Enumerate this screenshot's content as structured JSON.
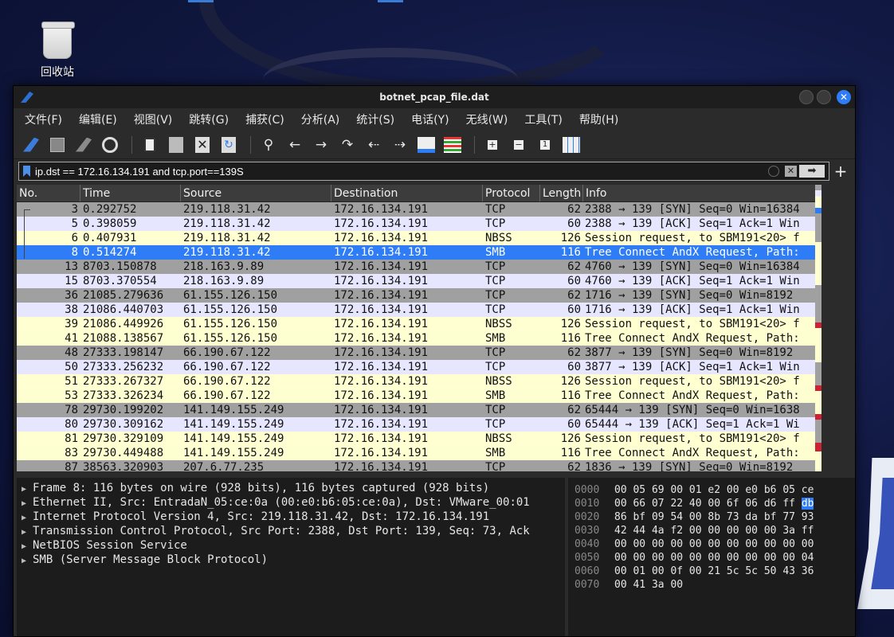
{
  "desktop": {
    "recycle_label": "回收站"
  },
  "window": {
    "title": "botnet_pcap_file.dat",
    "close_glyph": "✕"
  },
  "menu": [
    "文件(F)",
    "编辑(E)",
    "视图(V)",
    "跳转(G)",
    "捕获(C)",
    "分析(A)",
    "统计(S)",
    "电话(Y)",
    "无线(W)",
    "工具(T)",
    "帮助(H)"
  ],
  "toolbar": {
    "icons": [
      "shark-fin-start-icon",
      "stop-square-icon",
      "restart-fin-icon",
      "gear-options-icon",
      "open-file-icon",
      "file-set-icon",
      "close-file-icon",
      "reload-icon",
      "search-icon",
      "back-arrow-icon",
      "forward-arrow-icon",
      "goto-packet-icon",
      "first-packet-icon",
      "last-packet-icon",
      "autoscroll-icon",
      "colorize-icon",
      "zoom-in-icon",
      "zoom-out-icon",
      "normal-size-icon",
      "resize-columns-icon"
    ]
  },
  "filter": {
    "value": "ip.dst == 172.16.134.191 and tcp.port==139S",
    "apply_glyph": "➡",
    "plus": "+"
  },
  "columns": [
    "No.",
    "Time",
    "Source",
    "Destination",
    "Protocol",
    "Length",
    "Info"
  ],
  "packets": [
    {
      "no": "3",
      "time": "0.292752",
      "src": "219.118.31.42",
      "dst": "172.16.134.191",
      "proto": "TCP",
      "len": "62",
      "info": "2388 → 139 [SYN] Seq=0 Win=16384",
      "kind": "tcp"
    },
    {
      "no": "5",
      "time": "0.398059",
      "src": "219.118.31.42",
      "dst": "172.16.134.191",
      "proto": "TCP",
      "len": "60",
      "info": "2388 → 139 [ACK] Seq=1 Ack=1 Win",
      "kind": "tcp2"
    },
    {
      "no": "6",
      "time": "0.407931",
      "src": "219.118.31.42",
      "dst": "172.16.134.191",
      "proto": "NBSS",
      "len": "126",
      "info": "Session request, to SBM191<20> f",
      "kind": "nbss"
    },
    {
      "no": "8",
      "time": "0.514274",
      "src": "219.118.31.42",
      "dst": "172.16.134.191",
      "proto": "SMB",
      "len": "116",
      "info": "Tree Connect AndX Request, Path:",
      "kind": "sel"
    },
    {
      "no": "13",
      "time": "8703.150878",
      "src": "218.163.9.89",
      "dst": "172.16.134.191",
      "proto": "TCP",
      "len": "62",
      "info": "4760 → 139 [SYN] Seq=0 Win=16384",
      "kind": "tcp"
    },
    {
      "no": "15",
      "time": "8703.370554",
      "src": "218.163.9.89",
      "dst": "172.16.134.191",
      "proto": "TCP",
      "len": "60",
      "info": "4760 → 139 [ACK] Seq=1 Ack=1 Win",
      "kind": "tcp2"
    },
    {
      "no": "36",
      "time": "21085.279636",
      "src": "61.155.126.150",
      "dst": "172.16.134.191",
      "proto": "TCP",
      "len": "62",
      "info": "1716 → 139 [SYN] Seq=0 Win=8192",
      "kind": "tcp"
    },
    {
      "no": "38",
      "time": "21086.440703",
      "src": "61.155.126.150",
      "dst": "172.16.134.191",
      "proto": "TCP",
      "len": "60",
      "info": "1716 → 139 [ACK] Seq=1 Ack=1 Win",
      "kind": "tcp2"
    },
    {
      "no": "39",
      "time": "21086.449926",
      "src": "61.155.126.150",
      "dst": "172.16.134.191",
      "proto": "NBSS",
      "len": "126",
      "info": "Session request, to SBM191<20> f",
      "kind": "nbss"
    },
    {
      "no": "41",
      "time": "21088.138567",
      "src": "61.155.126.150",
      "dst": "172.16.134.191",
      "proto": "SMB",
      "len": "116",
      "info": "Tree Connect AndX Request, Path:",
      "kind": "smb"
    },
    {
      "no": "48",
      "time": "27333.198147",
      "src": "66.190.67.122",
      "dst": "172.16.134.191",
      "proto": "TCP",
      "len": "62",
      "info": "3877 → 139 [SYN] Seq=0 Win=8192",
      "kind": "tcp"
    },
    {
      "no": "50",
      "time": "27333.256232",
      "src": "66.190.67.122",
      "dst": "172.16.134.191",
      "proto": "TCP",
      "len": "60",
      "info": "3877 → 139 [ACK] Seq=1 Ack=1 Win",
      "kind": "tcp2"
    },
    {
      "no": "51",
      "time": "27333.267327",
      "src": "66.190.67.122",
      "dst": "172.16.134.191",
      "proto": "NBSS",
      "len": "126",
      "info": "Session request, to SBM191<20> f",
      "kind": "nbss"
    },
    {
      "no": "53",
      "time": "27333.326234",
      "src": "66.190.67.122",
      "dst": "172.16.134.191",
      "proto": "SMB",
      "len": "116",
      "info": "Tree Connect AndX Request, Path:",
      "kind": "smb"
    },
    {
      "no": "78",
      "time": "29730.199202",
      "src": "141.149.155.249",
      "dst": "172.16.134.191",
      "proto": "TCP",
      "len": "62",
      "info": "65444 → 139 [SYN] Seq=0 Win=1638",
      "kind": "tcp"
    },
    {
      "no": "80",
      "time": "29730.309162",
      "src": "141.149.155.249",
      "dst": "172.16.134.191",
      "proto": "TCP",
      "len": "60",
      "info": "65444 → 139 [ACK] Seq=1 Ack=1 Wi",
      "kind": "tcp2"
    },
    {
      "no": "81",
      "time": "29730.329109",
      "src": "141.149.155.249",
      "dst": "172.16.134.191",
      "proto": "NBSS",
      "len": "126",
      "info": "Session request, to SBM191<20> f",
      "kind": "nbss"
    },
    {
      "no": "83",
      "time": "29730.449488",
      "src": "141.149.155.249",
      "dst": "172.16.134.191",
      "proto": "SMB",
      "len": "116",
      "info": "Tree Connect AndX Request, Path:",
      "kind": "smb"
    },
    {
      "no": "87",
      "time": "38563.320903",
      "src": "207.6.77.235",
      "dst": "172.16.134.191",
      "proto": "TCP",
      "len": "62",
      "info": "1836 → 139 [SYN] Seq=0 Win=8192",
      "kind": "tcp"
    }
  ],
  "details": [
    "Frame 8: 116 bytes on wire (928 bits), 116 bytes captured (928 bits)",
    "Ethernet II, Src: EntradaN_05:ce:0a (00:e0:b6:05:ce:0a), Dst: VMware_00:01",
    "Internet Protocol Version 4, Src: 219.118.31.42, Dst: 172.16.134.191",
    "Transmission Control Protocol, Src Port: 2388, Dst Port: 139, Seq: 73, Ack",
    "NetBIOS Session Service",
    "SMB (Server Message Block Protocol)"
  ],
  "bytes": [
    {
      "off": "0000",
      "hex": "00 05 69 00 01 e2 00 e0  b6 05 ce",
      "hl": ""
    },
    {
      "off": "0010",
      "hex": "00 66 07 22 40 00 6f 06  d6 ff ",
      "hl": "db"
    },
    {
      "off": "0020",
      "hex": "86 bf 09 54 00 8b 73 da  bf 77 93",
      "hl": ""
    },
    {
      "off": "0030",
      "hex": "42 44 4a f2 00 00 00 00  00 3a ff",
      "hl": ""
    },
    {
      "off": "0040",
      "hex": "00 00 00 00 00 00 00 00  00 00 00",
      "hl": ""
    },
    {
      "off": "0050",
      "hex": "00 00 00 00 00 00 00 00  00 00 04",
      "hl": ""
    },
    {
      "off": "0060",
      "hex": "00 01 00 0f 00 21 5c 5c  50 43 36",
      "hl": ""
    },
    {
      "off": "0070",
      "hex": "00 41 3a 00",
      "hl": ""
    }
  ]
}
